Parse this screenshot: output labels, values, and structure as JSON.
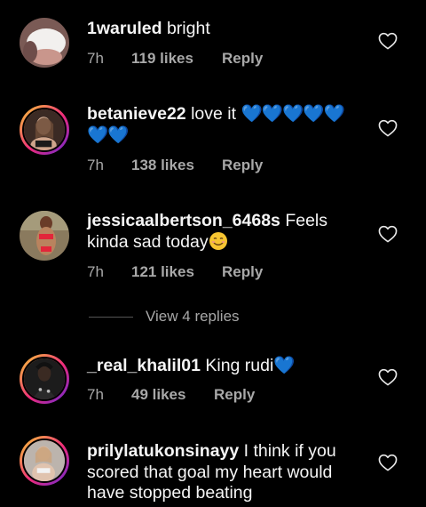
{
  "comments": [
    {
      "username": "1waruled",
      "text": " bright",
      "time": "7h",
      "likes": "119 likes",
      "reply": "Reply",
      "has_ring": false
    },
    {
      "username": "betanieve22",
      "text": " love it ",
      "emoji": "💙💙💙💙💙 💙💙",
      "time": "7h",
      "likes": "138 likes",
      "reply": "Reply",
      "has_ring": true
    },
    {
      "username": "jessicaalbertson_6468s",
      "text": " Feels kinda sad today",
      "time": "7h",
      "likes": "121 likes",
      "reply": "Reply",
      "has_ring": false
    },
    {
      "username": "_real_khalil01",
      "text": " King rudi",
      "emoji": "💙",
      "time": "7h",
      "likes": "49 likes",
      "reply": "Reply",
      "has_ring": true
    },
    {
      "username": "prilylatukonsinayy",
      "text": " I think if you scored that goal my heart would have stopped beating",
      "has_ring": true
    }
  ],
  "view_replies": "View 4 replies",
  "icons": {
    "like": "heart-outline-icon",
    "emoji_smile": "smiling-face-emoji"
  },
  "colors": {
    "background": "#000000",
    "meta": "#a8a8a8",
    "heart_emoji": "#1a8cff"
  }
}
